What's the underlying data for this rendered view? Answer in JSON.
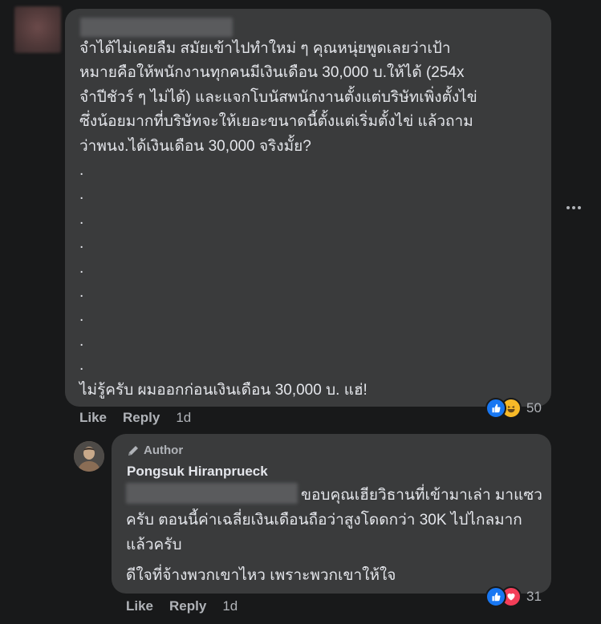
{
  "comment": {
    "text": "จำได้ไม่เคยลืม สมัยเข้าไปทำใหม่ ๆ คุณหนุ่ยพูดเลยว่าเป้า\nหมายคือให้พนักงานทุกคนมีเงินเดือน 30,000 บ.ให้ได้ (254x\nจำปีชัวร์ ๆ ไม่ได้) และแจกโบนัสพนักงานตั้งแต่บริษัทเพิ่งตั้งไข่\nซึ่งน้อยมากที่บริษัทจะให้เยอะขนาดนี้ตั้งแต่เริ่มตั้งไข่ แล้วถาม\nว่าพนง.ได้เงินเดือน 30,000 จริงมั้ย?\n.\n.\n.\n.\n.\n.\n.\n.\n.\nไม่รู้ครับ ผมออกก่อนเงินเดือน 30,000 บ. แฮ่!",
    "like_label": "Like",
    "reply_label": "Reply",
    "time": "1d",
    "reaction_count": "50",
    "reaction_icons": [
      "like-icon",
      "haha-icon"
    ]
  },
  "reply": {
    "badge": "Author",
    "author": "Pongsuk Hiranprueck",
    "text_1": "ขอบคุณเฮียวิธานที่เข้ามาเล่า มาแซวครับ ตอนนี้ค่าเฉลี่ยเงินเดือนถือว่าสูงโดดกว่า 30K ไปไกลมากแล้วครับ",
    "text_2": "ดีใจที่จ้างพวกเขาไหว เพราะพวกเขาให้ใจ",
    "like_label": "Like",
    "reply_label": "Reply",
    "time": "1d",
    "reaction_count": "31",
    "reaction_icons": [
      "like-icon",
      "love-icon"
    ]
  },
  "colors": {
    "background": "#18191a",
    "bubble": "#3a3b3c",
    "text_primary": "#e4e6eb",
    "text_secondary": "#b0b3b8",
    "like_blue": "#1877f2",
    "love_red": "#f33e58",
    "haha_yellow": "#f7b928"
  }
}
